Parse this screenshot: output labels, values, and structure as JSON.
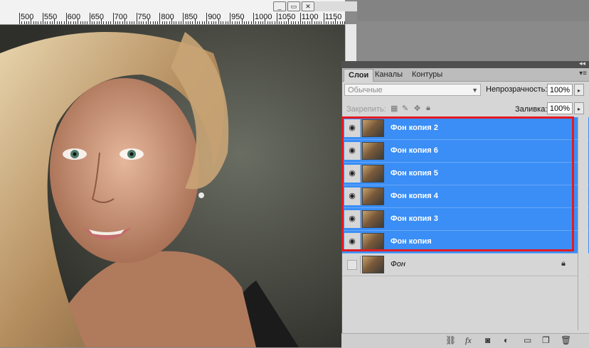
{
  "ruler": {
    "labels": [
      "500",
      "550",
      "600",
      "650",
      "700",
      "750",
      "800",
      "850",
      "900",
      "950",
      "1000",
      "1050",
      "1100",
      "1150"
    ]
  },
  "panel": {
    "tabs": [
      "Слои",
      "Каналы",
      "Контуры"
    ],
    "blend_mode": "Обычные",
    "opacity_label": "Непрозрачность:",
    "opacity_value": "100%",
    "lock_label": "Закрепить:",
    "fill_label": "Заливка:",
    "fill_value": "100%",
    "layers": [
      {
        "name": "Фон копия 2",
        "selected": true
      },
      {
        "name": "Фон копия 6",
        "selected": true
      },
      {
        "name": "Фон копия 5",
        "selected": true
      },
      {
        "name": "Фон копия 4",
        "selected": true
      },
      {
        "name": "Фон копия 3",
        "selected": true
      },
      {
        "name": "Фон копия",
        "selected": true
      },
      {
        "name": "Фон",
        "selected": false
      }
    ]
  },
  "colors": {
    "selection": "#3a8ef6",
    "highlight_border": "#e31b23",
    "panel_bg": "#d6d6d6"
  },
  "icons": {
    "eye": "eye-icon",
    "lock": "lock-icon",
    "link": "link-icon",
    "fx": "fx-icon",
    "mask": "mask-icon",
    "adjustment": "adjustment-icon",
    "folder": "folder-icon",
    "new_layer": "new-layer-icon",
    "trash": "trash-icon"
  }
}
